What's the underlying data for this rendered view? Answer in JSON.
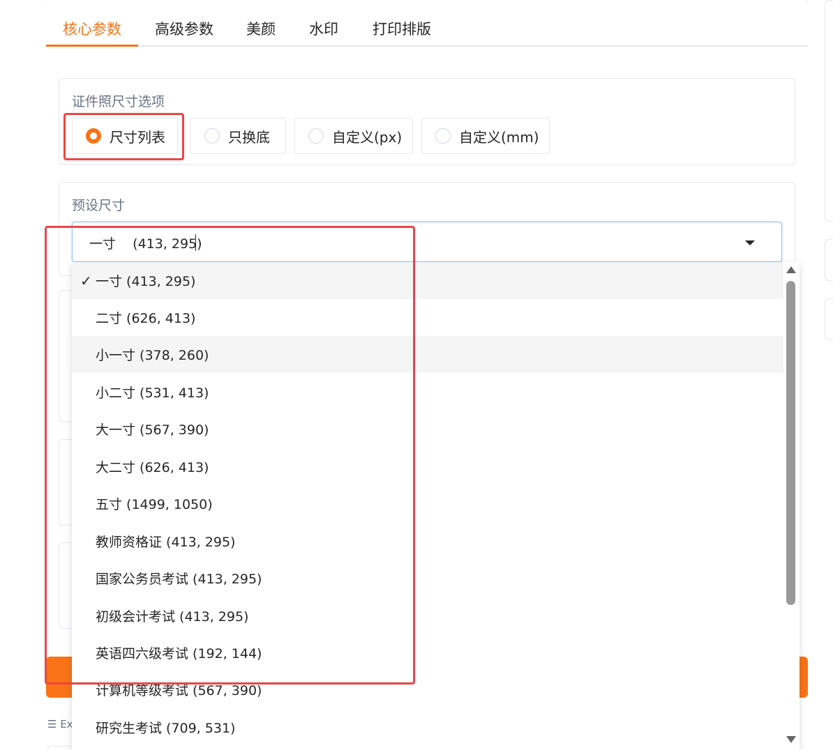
{
  "tabs": [
    {
      "label": "核心参数",
      "active": true
    },
    {
      "label": "高级参数",
      "active": false
    },
    {
      "label": "美颜",
      "active": false
    },
    {
      "label": "水印",
      "active": false
    },
    {
      "label": "打印排版",
      "active": false
    }
  ],
  "size_options": {
    "label": "证件照尺寸选项",
    "options": [
      {
        "label": "尺寸列表",
        "checked": true
      },
      {
        "label": "只换底",
        "checked": false
      },
      {
        "label": "自定义(px)",
        "checked": false
      },
      {
        "label": "自定义(mm)",
        "checked": false
      }
    ]
  },
  "preset": {
    "label": "预设尺寸",
    "value": "一寸    (413, 295)",
    "items": [
      {
        "label": "一寸 (413, 295)",
        "selected": true,
        "check": "✓"
      },
      {
        "label": "二寸 (626, 413)",
        "selected": false
      },
      {
        "label": "小一寸 (378, 260)",
        "selected": false,
        "hover": true
      },
      {
        "label": "小二寸 (531, 413)",
        "selected": false
      },
      {
        "label": "大一寸 (567, 390)",
        "selected": false
      },
      {
        "label": "大二寸 (626, 413)",
        "selected": false
      },
      {
        "label": "五寸 (1499, 1050)",
        "selected": false
      },
      {
        "label": "教师资格证 (413, 295)",
        "selected": false
      },
      {
        "label": "国家公务员考试 (413, 295)",
        "selected": false
      },
      {
        "label": "初级会计考试 (413, 295)",
        "selected": false
      },
      {
        "label": "英语四六级考试 (192, 144)",
        "selected": false
      },
      {
        "label": "计算机等级考试 (567, 390)",
        "selected": false
      },
      {
        "label": "研究生考试 (709, 531)",
        "selected": false
      }
    ]
  },
  "examples": {
    "icon": "list-icon",
    "label": "Ex"
  },
  "colors": {
    "accent": "#f97316",
    "highlight": "#ef4444"
  }
}
